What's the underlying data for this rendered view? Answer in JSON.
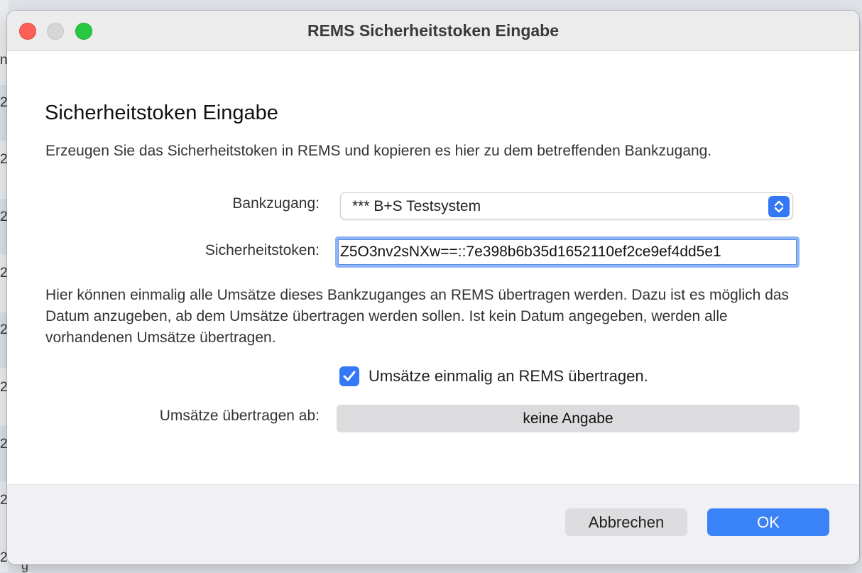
{
  "window": {
    "title": "REMS Sicherheitstoken Eingabe"
  },
  "background": {
    "edge_chars": [
      "n",
      "2",
      "2",
      "2",
      "2",
      "2",
      "2",
      "2",
      "2",
      "2",
      "2",
      "2"
    ],
    "bottom_text": "g"
  },
  "dialog": {
    "heading": "Sicherheitstoken Eingabe",
    "intro": "Erzeugen Sie das Sicherheitstoken in REMS und kopieren es hier zu dem betreffenden Bankzugang.",
    "bank_label": "Bankzugang:",
    "bank_value": "*** B+S Testsystem",
    "token_label": "Sicherheitstoken:",
    "token_value": "Z5O3nv2sNXw==::7e398b6b35d1652110ef2ce9ef4dd5e1",
    "info": "Hier können einmalig alle Umsätze dieses Bankzuganges an REMS übertragen werden. Dazu ist es möglich das Datum anzugeben, ab dem Umsätze übertragen werden sollen. Ist kein Datum angegeben, werden alle vorhandenen Umsätze übertragen.",
    "transfer_checkbox_label": "Umsätze einmalig an REMS übertragen.",
    "transfer_checkbox_checked": true,
    "date_label": "Umsätze übertragen ab:",
    "date_value": "keine Angabe"
  },
  "buttons": {
    "cancel": "Abbrechen",
    "ok": "OK"
  },
  "colors": {
    "accent": "#3478f6",
    "close": "#fe5f57",
    "zoom": "#28c840"
  }
}
